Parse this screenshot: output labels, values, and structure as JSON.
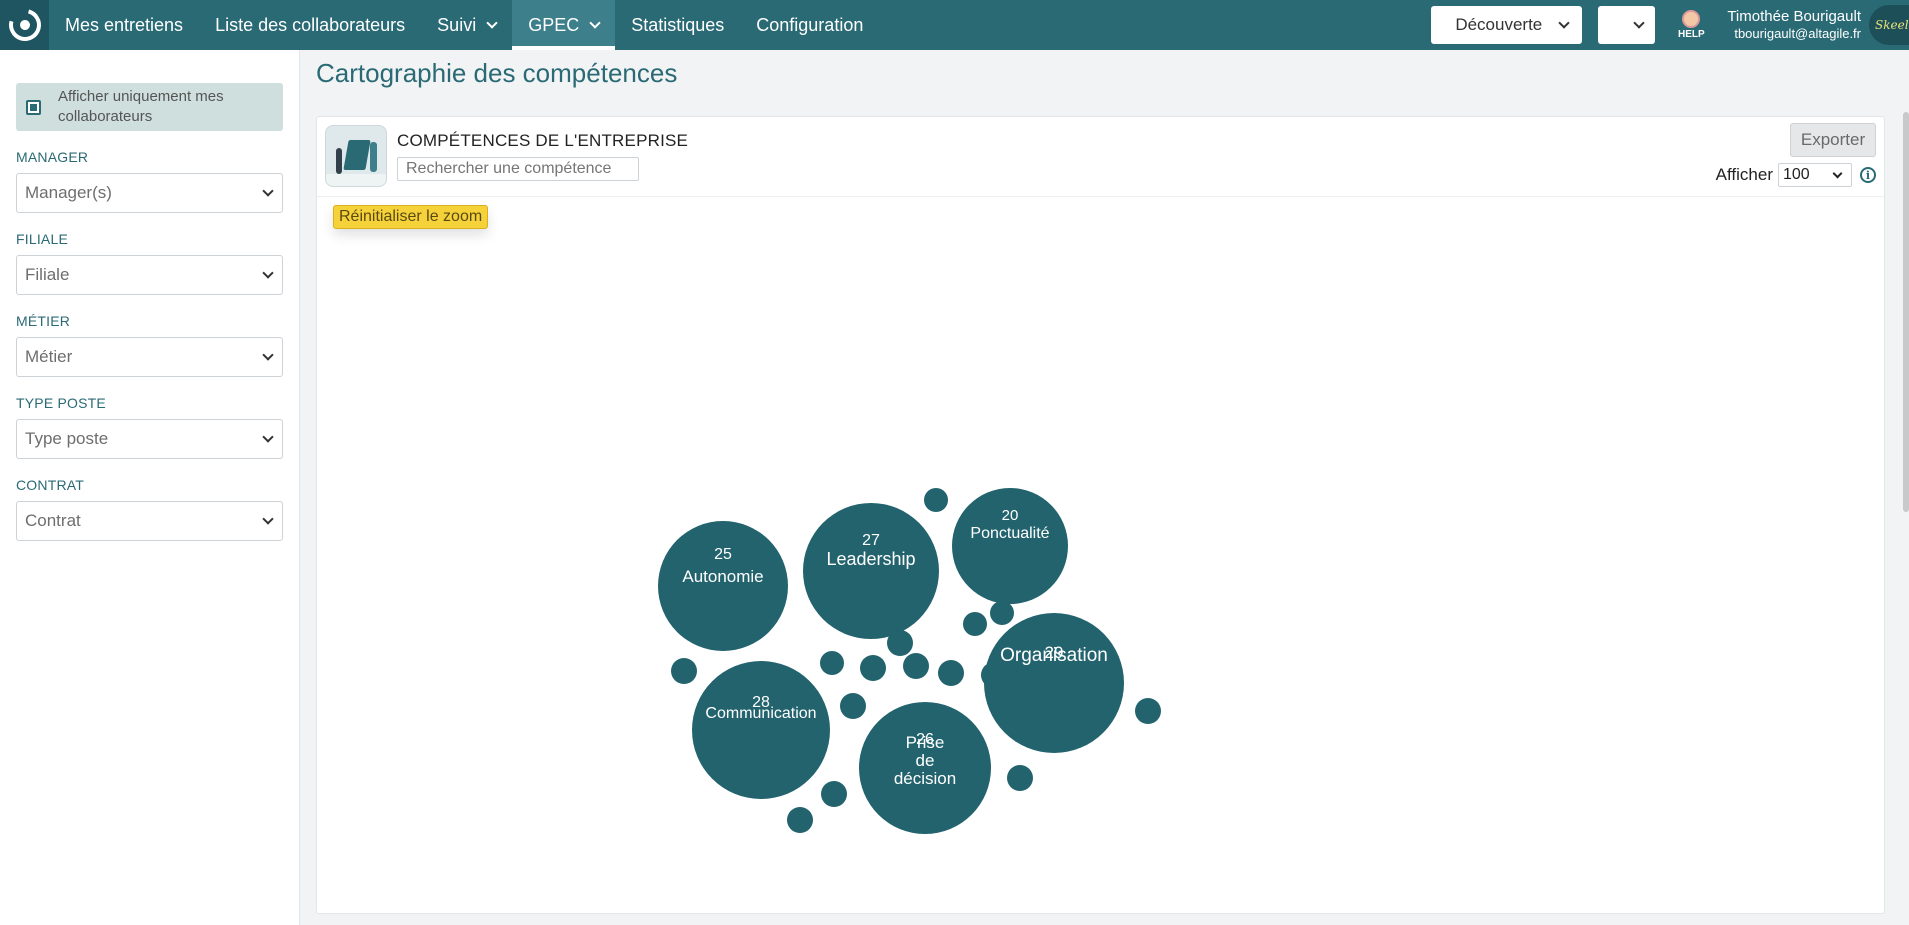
{
  "nav": {
    "items": [
      {
        "label": "Mes entretiens"
      },
      {
        "label": "Liste des collaborateurs"
      },
      {
        "label": "Suivi"
      },
      {
        "label": "GPEC"
      },
      {
        "label": "Statistiques"
      },
      {
        "label": "Configuration"
      }
    ],
    "mode_select": "Découverte",
    "help_label": "HELP",
    "user": {
      "name": "Timothée Bourigault",
      "email": "tbourigault@altagile.fr"
    },
    "avatar_text": "Skeel"
  },
  "sidebar": {
    "only_mine_label": "Afficher uniquement mes collaborateurs",
    "filters": [
      {
        "label": "MANAGER",
        "value": "Manager(s)"
      },
      {
        "label": "FILIALE",
        "value": "Filiale"
      },
      {
        "label": "MÉTIER",
        "value": "Métier"
      },
      {
        "label": "TYPE POSTE",
        "value": "Type poste"
      },
      {
        "label": "CONTRAT",
        "value": "Contrat"
      }
    ]
  },
  "page": {
    "title": "Cartographie des compétences",
    "card_title": "COMPÉTENCES DE L'ENTREPRISE",
    "search_placeholder": "Rechercher une compétence",
    "export_label": "Exporter",
    "show_label": "Afficher",
    "show_value": "100",
    "info_glyph": "i",
    "reset_zoom_label": "Réinitialiser le zoom"
  },
  "colors": {
    "primary": "#2a6a75",
    "bubble": "#22636e",
    "reset_btn": "#f6d23a"
  },
  "chart_data": {
    "type": "bubble",
    "series": [
      {
        "name": "Organisation",
        "value": 29
      },
      {
        "name": "Communication",
        "value": 28
      },
      {
        "name": "Leadership",
        "value": 27
      },
      {
        "name": "Prise de décision",
        "value": 26
      },
      {
        "name": "Autonomie",
        "value": 25
      },
      {
        "name": "Ponctualité",
        "value": 20
      }
    ],
    "small_bubbles": 15
  }
}
